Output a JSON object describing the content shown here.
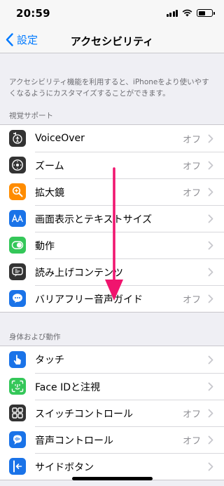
{
  "status_bar": {
    "time": "20:59",
    "battery_level": 0.55
  },
  "nav": {
    "back_label": "設定",
    "title": "アクセシビリティ"
  },
  "description": "アクセシビリティ機能を利用すると、iPhoneをより使いやすくなるようにカスタマイズすることができます。",
  "sections": [
    {
      "header": "視覚サポート",
      "rows": [
        {
          "label": "VoiceOver",
          "value": "オフ",
          "icon": "voiceover-icon",
          "color": "#333333"
        },
        {
          "label": "ズーム",
          "value": "オフ",
          "icon": "zoom-icon",
          "color": "#333333"
        },
        {
          "label": "拡大鏡",
          "value": "オフ",
          "icon": "magnifier-icon",
          "color": "#ff8c00"
        },
        {
          "label": "画面表示とテキストサイズ",
          "value": "",
          "icon": "text-size-icon",
          "color": "#1a73e8"
        },
        {
          "label": "動作",
          "value": "",
          "icon": "motion-icon",
          "color": "#34c759"
        },
        {
          "label": "読み上げコンテンツ",
          "value": "",
          "icon": "spoken-content-icon",
          "color": "#333333"
        },
        {
          "label": "バリアフリー音声ガイド",
          "value": "オフ",
          "icon": "audio-description-icon",
          "color": "#1a73e8"
        }
      ]
    },
    {
      "header": "身体および動作",
      "rows": [
        {
          "label": "タッチ",
          "value": "",
          "icon": "touch-icon",
          "color": "#1a73e8"
        },
        {
          "label": "Face IDと注視",
          "value": "",
          "icon": "face-id-icon",
          "color": "#34c759"
        },
        {
          "label": "スイッチコントロール",
          "value": "オフ",
          "icon": "switch-control-icon",
          "color": "#333333"
        },
        {
          "label": "音声コントロール",
          "value": "オフ",
          "icon": "voice-control-icon",
          "color": "#1a73e8"
        },
        {
          "label": "サイドボタン",
          "value": "",
          "icon": "side-button-icon",
          "color": "#1a73e8"
        }
      ]
    }
  ],
  "colors": {
    "accent": "#007aff",
    "annotation_arrow": "#f0146e"
  }
}
